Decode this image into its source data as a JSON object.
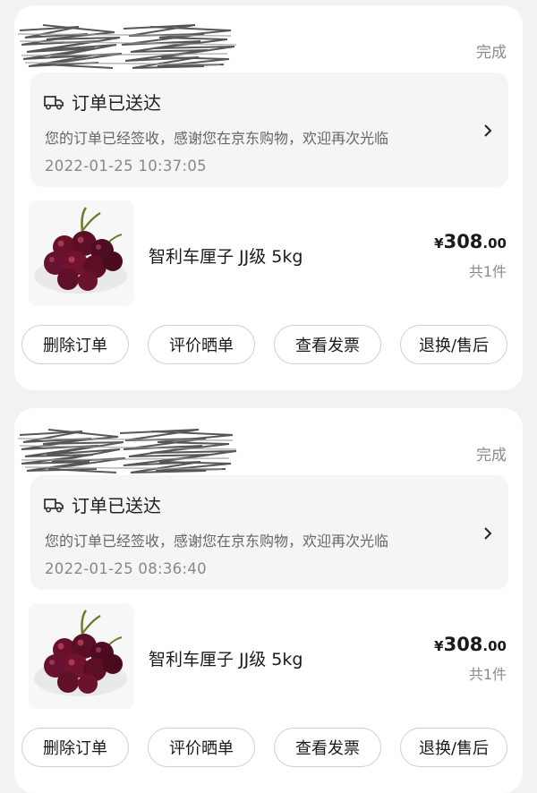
{
  "orders": [
    {
      "status": "完成",
      "tracking": {
        "title": "订单已送达",
        "description": "您的订单已经签收，感谢您在京东购物，欢迎再次光临",
        "time": "2022-01-25 10:37:05"
      },
      "product": {
        "name": "智利车厘子 JJ级 5kg",
        "price_currency": "¥",
        "price_integer": "308",
        "price_decimal": ".00",
        "quantity": "共1件"
      },
      "buttons": {
        "delete": "删除订单",
        "review": "评价晒单",
        "invoice": "查看发票",
        "return": "退换/售后"
      }
    },
    {
      "status": "完成",
      "tracking": {
        "title": "订单已送达",
        "description": "您的订单已经签收，感谢您在京东购物，欢迎再次光临",
        "time": "2022-01-25 08:36:40"
      },
      "product": {
        "name": "智利车厘子 JJ级 5kg",
        "price_currency": "¥",
        "price_integer": "308",
        "price_decimal": ".00",
        "quantity": "共1件"
      },
      "buttons": {
        "delete": "删除订单",
        "review": "评价晒单",
        "invoice": "查看发票",
        "return": "退换/售后"
      }
    }
  ],
  "colors": {
    "background": "#f2f2f2",
    "card": "#ffffff",
    "tracking_box": "#f5f5f5",
    "muted_text": "#8a8a8a",
    "cherry": "#5a0f25"
  }
}
